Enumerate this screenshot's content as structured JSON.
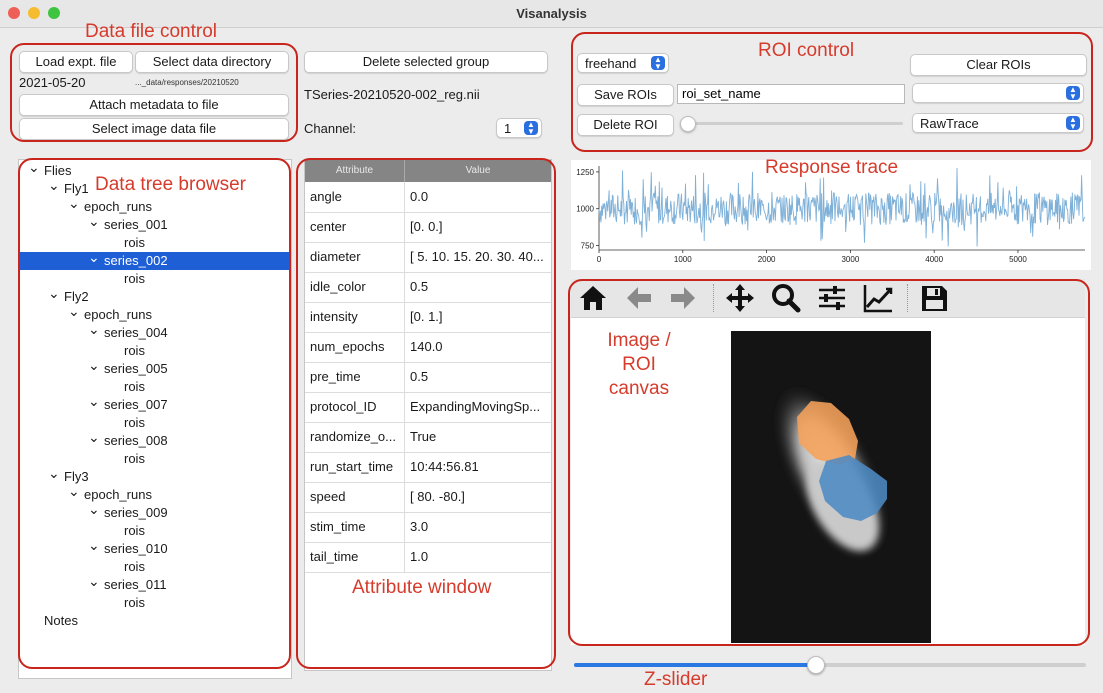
{
  "window": {
    "title": "Visanalysis"
  },
  "data_file": {
    "load_button": "Load expt. file",
    "select_dir_button": "Select data directory",
    "date": "2021-05-20",
    "dir_path": "..._data/responses/20210520",
    "attach_button": "Attach metadata to file",
    "select_image_button": "Select image data file",
    "delete_group_button": "Delete selected group",
    "image_file": "TSeries-20210520-002_reg.nii",
    "channel_label": "Channel:",
    "channel_value": "1"
  },
  "roi": {
    "mode": "freehand",
    "clear_button": "Clear ROIs",
    "save_button": "Save ROIs",
    "set_name": "roi_set_name",
    "set_select": "",
    "delete_button": "Delete ROI",
    "trace_type": "RawTrace",
    "slider_value": 0
  },
  "tree": [
    {
      "label": "Flies",
      "depth": 0,
      "arrow": true,
      "selected": false
    },
    {
      "label": "Fly1",
      "depth": 1,
      "arrow": true,
      "selected": false
    },
    {
      "label": "epoch_runs",
      "depth": 2,
      "arrow": true,
      "selected": false
    },
    {
      "label": "series_001",
      "depth": 3,
      "arrow": true,
      "selected": false
    },
    {
      "label": "rois",
      "depth": 4,
      "arrow": false,
      "selected": false
    },
    {
      "label": "series_002",
      "depth": 3,
      "arrow": true,
      "selected": true
    },
    {
      "label": "rois",
      "depth": 4,
      "arrow": false,
      "selected": false
    },
    {
      "label": "Fly2",
      "depth": 1,
      "arrow": true,
      "selected": false
    },
    {
      "label": "epoch_runs",
      "depth": 2,
      "arrow": true,
      "selected": false
    },
    {
      "label": "series_004",
      "depth": 3,
      "arrow": true,
      "selected": false
    },
    {
      "label": "rois",
      "depth": 4,
      "arrow": false,
      "selected": false
    },
    {
      "label": "series_005",
      "depth": 3,
      "arrow": true,
      "selected": false
    },
    {
      "label": "rois",
      "depth": 4,
      "arrow": false,
      "selected": false
    },
    {
      "label": "series_007",
      "depth": 3,
      "arrow": true,
      "selected": false
    },
    {
      "label": "rois",
      "depth": 4,
      "arrow": false,
      "selected": false
    },
    {
      "label": "series_008",
      "depth": 3,
      "arrow": true,
      "selected": false
    },
    {
      "label": "rois",
      "depth": 4,
      "arrow": false,
      "selected": false
    },
    {
      "label": "Fly3",
      "depth": 1,
      "arrow": true,
      "selected": false
    },
    {
      "label": "epoch_runs",
      "depth": 2,
      "arrow": true,
      "selected": false
    },
    {
      "label": "series_009",
      "depth": 3,
      "arrow": true,
      "selected": false
    },
    {
      "label": "rois",
      "depth": 4,
      "arrow": false,
      "selected": false
    },
    {
      "label": "series_010",
      "depth": 3,
      "arrow": true,
      "selected": false
    },
    {
      "label": "rois",
      "depth": 4,
      "arrow": false,
      "selected": false
    },
    {
      "label": "series_011",
      "depth": 3,
      "arrow": true,
      "selected": false
    },
    {
      "label": "rois",
      "depth": 4,
      "arrow": false,
      "selected": false
    },
    {
      "label": "Notes",
      "depth": 0,
      "arrow": false,
      "selected": false
    }
  ],
  "attributes": {
    "headers": [
      "Attribute",
      "Value"
    ],
    "rows": [
      [
        "angle",
        "0.0"
      ],
      [
        "center",
        "[0. 0.]"
      ],
      [
        "diameter",
        "[ 5. 10. 15. 20. 30. 40..."
      ],
      [
        "idle_color",
        "0.5"
      ],
      [
        "intensity",
        "[0. 1.]"
      ],
      [
        "num_epochs",
        "140.0"
      ],
      [
        "pre_time",
        "0.5"
      ],
      [
        "protocol_ID",
        "ExpandingMovingSp..."
      ],
      [
        "randomize_o...",
        "True"
      ],
      [
        "run_start_time",
        "10:44:56.81"
      ],
      [
        "speed",
        "[ 80. -80.]"
      ],
      [
        "stim_time",
        "3.0"
      ],
      [
        "tail_time",
        "1.0"
      ]
    ]
  },
  "toolbar": {
    "icons": [
      "home-icon",
      "back-arrow-icon",
      "forward-arrow-icon",
      "pan-icon",
      "zoom-icon",
      "configure-icon",
      "edit-axis-icon",
      "save-icon"
    ]
  },
  "z_slider": {
    "value": 0.47
  },
  "annotations": {
    "data_file_control": "Data file control",
    "roi_control": "ROI control",
    "data_tree_browser": "Data tree browser",
    "response_trace": "Response trace",
    "image_roi_canvas": "Image / ROI\ncanvas",
    "attribute_window": "Attribute window",
    "z_slider": "Z-slider"
  },
  "chart_data": {
    "type": "line",
    "title": "",
    "xlabel": "",
    "ylabel": "",
    "xlim": [
      0,
      5800
    ],
    "ylim": [
      720,
      1290
    ],
    "xticks": [
      0,
      1000,
      2000,
      3000,
      4000,
      5000
    ],
    "yticks": [
      750,
      1000,
      1250
    ],
    "series": [
      {
        "color": "#7eb0d8",
        "n": 5800,
        "mean": 1000,
        "amplitude": 110,
        "spike_max": 1280,
        "spike_min": 740
      }
    ],
    "grid": false
  },
  "colors": {
    "annotation_red": "#c8261d",
    "selection_blue": "#1e5fd6",
    "trace_blue": "#7eb0d8",
    "roi_orange": "#f5a25a",
    "roi_blue": "#4d8ac3"
  }
}
